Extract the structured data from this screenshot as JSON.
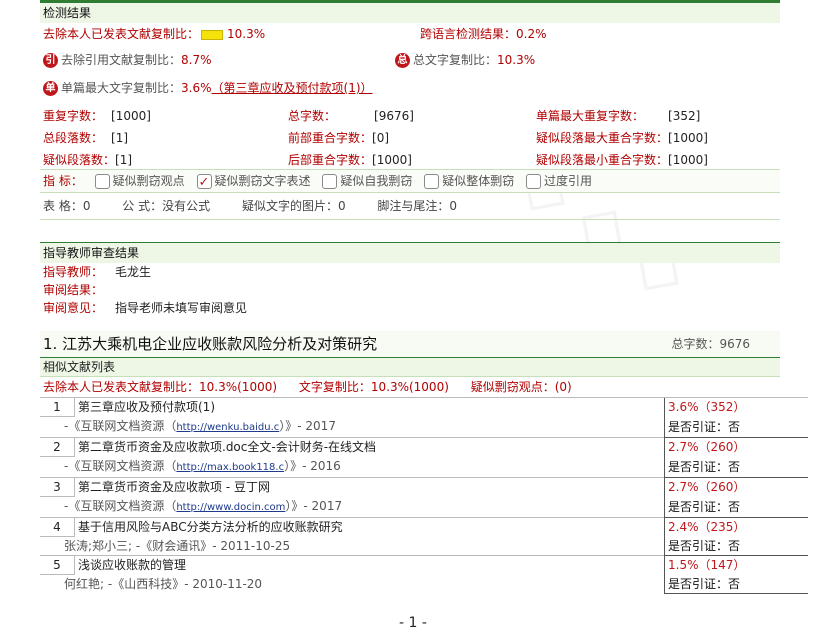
{
  "result": {
    "header": "检测结果",
    "excl_label": "去除本人已发表文献复制比：",
    "excl_value": "10.3%",
    "cross_label": "跨语言检测结果：",
    "cross_value": "0.2%",
    "cite_icon": "引",
    "cite_label": "去除引用文献复制比：",
    "cite_value": "8.7%",
    "total_icon": "总",
    "total_label": "总文字复制比：",
    "total_value": "10.3%",
    "single_icon": "单",
    "single_label": "单篇最大文字复制比：",
    "single_value": "3.6%",
    "single_source": "（第三章应收及预付款项(1)）"
  },
  "stats": {
    "dup_chars_label": "重复字数：",
    "dup_chars_value": "[1000]",
    "total_chars_label": "总字数：",
    "total_chars_value": "[9676]",
    "single_max_label": "单篇最大重复字数：",
    "single_max_value": "[352]",
    "paras_label": "总段落数：",
    "paras_value": "[1]",
    "front_label": "前部重合字数：",
    "front_value": "[0]",
    "susp_max_label": "疑似段落最大重合字数：",
    "susp_max_value": "[1000]",
    "susp_paras_label": "疑似段落数：",
    "susp_paras_value": "[1]",
    "back_label": "后部重合字数：",
    "back_value": "[1000]",
    "susp_min_label": "疑似段落最小重合字数：",
    "susp_min_value": "[1000]"
  },
  "indicators": {
    "label": "指  标：",
    "items": [
      {
        "label": "疑似剽窃观点",
        "checked": false
      },
      {
        "label": "疑似剽窃文字表述",
        "checked": true
      },
      {
        "label": "疑似自我剽窃",
        "checked": false
      },
      {
        "label": "疑似整体剽窃",
        "checked": false
      },
      {
        "label": "过度引用",
        "checked": false
      }
    ]
  },
  "misc": {
    "tables": "表  格：0",
    "formula": "公  式：没有公式",
    "images": "疑似文字的图片：0",
    "footnotes": "脚注与尾注：0"
  },
  "teacher": {
    "header": "指导教师审查结果",
    "name_label": "指导教师：",
    "name_value": "毛龙生",
    "result_label": "审阅结果：",
    "result_value": "",
    "opinion_label": "审阅意见：",
    "opinion_value": "指导老师未填写审阅意见"
  },
  "section": {
    "title": "1. 江苏大乘机电企业应收账款风险分析及对策研究",
    "total": "总字数：9676",
    "list_header": "相似文献列表",
    "sum_excl": "去除本人已发表文献复制比：10.3%(1000)",
    "sum_copy": "文字复制比：10.3%(1000)",
    "sum_view": "疑似剽窃观点：(0)"
  },
  "literature": [
    {
      "num": "1",
      "title": "第三章应收及预付款项(1)",
      "pct": "3.6%（352）",
      "src_pre": "-《互联网文档资源（",
      "link": "http://wenku.baidu.c",
      "src_post": "）》- 2017",
      "cite": "是否引证：否"
    },
    {
      "num": "2",
      "title": "第二章货币资金及应收款项.doc全文-会计财务-在线文档",
      "pct": "2.7%（260）",
      "src_pre": "-《互联网文档资源（",
      "link": "http://max.book118.c",
      "src_post": "）》- 2016",
      "cite": "是否引证：否"
    },
    {
      "num": "3",
      "title": "第二章货币资金及应收款项 - 豆丁网",
      "pct": "2.7%（260）",
      "src_pre": "-《互联网文档资源（",
      "link": "http://www.docin.com",
      "src_post": "）》- 2017",
      "cite": "是否引证：否"
    },
    {
      "num": "4",
      "title": "基于信用风险与ABC分类方法分析的应收账款研究",
      "pct": "2.4%（235）",
      "src_pre": "张涛;郑小三; -《财会通讯》- 2011-10-25",
      "link": "",
      "src_post": "",
      "cite": "是否引证：否"
    },
    {
      "num": "5",
      "title": "浅谈应收账款的管理",
      "pct": "1.5%（147）",
      "src_pre": "何红艳; -《山西科技》- 2010-11-20",
      "link": "",
      "src_post": "",
      "cite": "是否引证：否"
    }
  ],
  "page_number": "- 1 -"
}
